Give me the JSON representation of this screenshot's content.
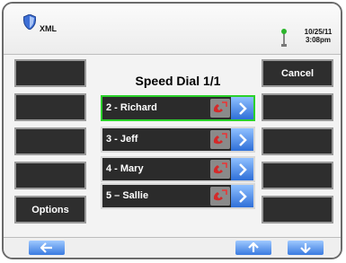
{
  "header": {
    "app_title": "XML",
    "date": "10/25/11",
    "time": "3:08pm"
  },
  "list": {
    "title": "Speed Dial 1/1",
    "items": [
      {
        "label": "2 - Richard",
        "selected": true
      },
      {
        "label": "3 - Jeff",
        "selected": false
      },
      {
        "label": "4 - Mary",
        "selected": false
      },
      {
        "label": "5 – Sallie",
        "selected": false
      }
    ]
  },
  "left_softkeys": [
    "",
    "",
    "",
    "",
    "Options"
  ],
  "right_softkeys": [
    "Cancel",
    "",
    "",
    "",
    ""
  ],
  "footer": {
    "icons": [
      "back-arrow-icon",
      "up-arrow-icon",
      "down-arrow-icon"
    ]
  },
  "colors": {
    "selection": "#2bd12b",
    "accent_blue": "#3a7be0",
    "softkey_bg": "#2e2e2e"
  }
}
